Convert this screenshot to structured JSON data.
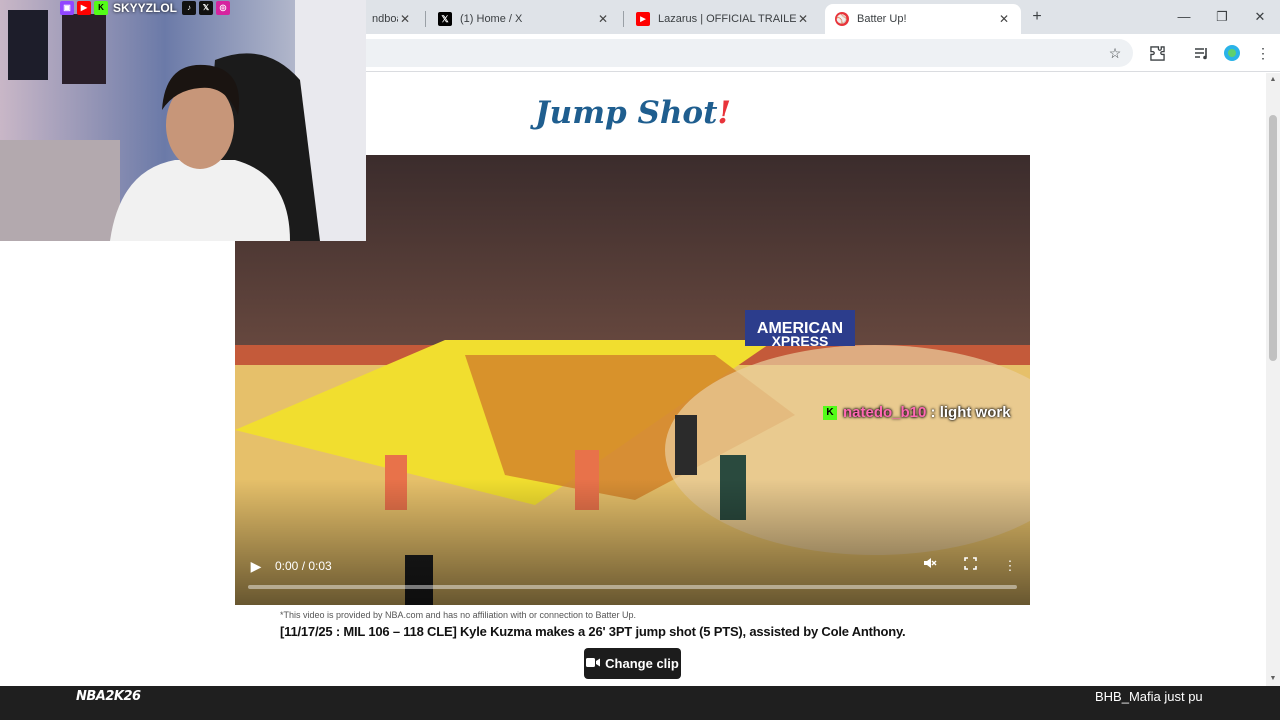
{
  "browser": {
    "tabs": [
      {
        "title": "ndboa",
        "favicon": "page-icon",
        "active": false
      },
      {
        "title": "(1) Home / X",
        "favicon": "x-icon",
        "active": false
      },
      {
        "title": "Lazarus | OFFICIAL TRAILER | ad",
        "favicon": "youtube-icon",
        "active": false
      },
      {
        "title": "Batter Up!",
        "favicon": "batter-up-icon",
        "active": true
      }
    ],
    "new_tab": "+",
    "window_controls": {
      "minimize": "—",
      "restore": "❐",
      "close": "✕"
    },
    "toolbar_icons": [
      "bookmark-star-icon",
      "extensions-icon",
      "reading-list-icon",
      "profile-icon",
      "menu-icon"
    ]
  },
  "page": {
    "heading": "Jump Shot",
    "heading_punct": "!",
    "video": {
      "time": "0:00 / 0:03",
      "progress": 0.0,
      "scene": "basketball-game-footage",
      "chat_overlay": {
        "badge": "K",
        "user": "natedo_b10",
        "separator": " : ",
        "message": "light work"
      }
    },
    "disclaimer": "*This video is provided by NBA.com and has no affiliation with or connection to Batter Up.",
    "caption": "[11/17/25 : MIL 106 – 118 CLE] Kyle Kuzma makes a 26' 3PT jump shot (5 PTS), assisted by Cole Anthony.",
    "change_clip_label": "Change clip",
    "change_clip_icon": "camera-icon"
  },
  "webcam": {
    "streamer_name": "SKYYZLOL",
    "social_icons": [
      "twitch-icon",
      "youtube-icon",
      "kick-icon",
      "tiktok-icon",
      "x-icon",
      "instagram-icon"
    ]
  },
  "stream_bar": {
    "logo_text": "NBA2K26",
    "logo_prefix": "NBA",
    "logo_number": "26",
    "ticker": "BHB_Mafia just pu"
  },
  "colors": {
    "heading_blue": "#1f5e8f",
    "heading_red": "#e8343b",
    "chat_user_pink": "#ff69b4",
    "kick_green": "#53fc18"
  }
}
